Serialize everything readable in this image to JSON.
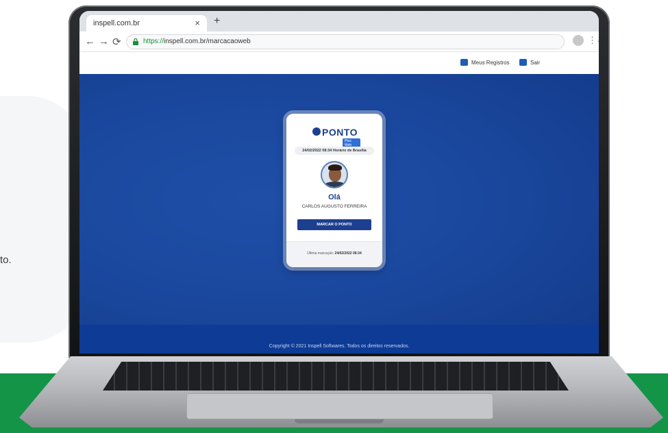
{
  "edge_text": "to.",
  "browser": {
    "tab_title": "inspell.com.br",
    "tab_close": "×",
    "new_tab": "+",
    "back": "←",
    "forward": "→",
    "reload": "⟳",
    "url_protocol": "https://",
    "url_rest": "inspell.com.br/marcacaoweb",
    "bookmark": "☆",
    "menu": "⋮"
  },
  "app": {
    "header_links": [
      "Meus Registros",
      "Sair"
    ],
    "card": {
      "logo_text": "PONTO",
      "logo_sub": "Plus Web",
      "datetime": "24/02/2022 08:34 Horário de Brasília",
      "greeting": "Olá",
      "user_name": "CARLOS AUGUSTO FERREIRA",
      "mark_button": "MARCAR O PONTO",
      "last_mark_label": "Última marcação:",
      "last_mark_value": "24/02/2022 08:34"
    },
    "footer": "Copyright © 2021 Inspell Softwares. Todos os direitos reservados."
  },
  "colors": {
    "brand_blue": "#1d3f8f",
    "page_blue": "#1b49a0",
    "green_band": "#149447"
  }
}
